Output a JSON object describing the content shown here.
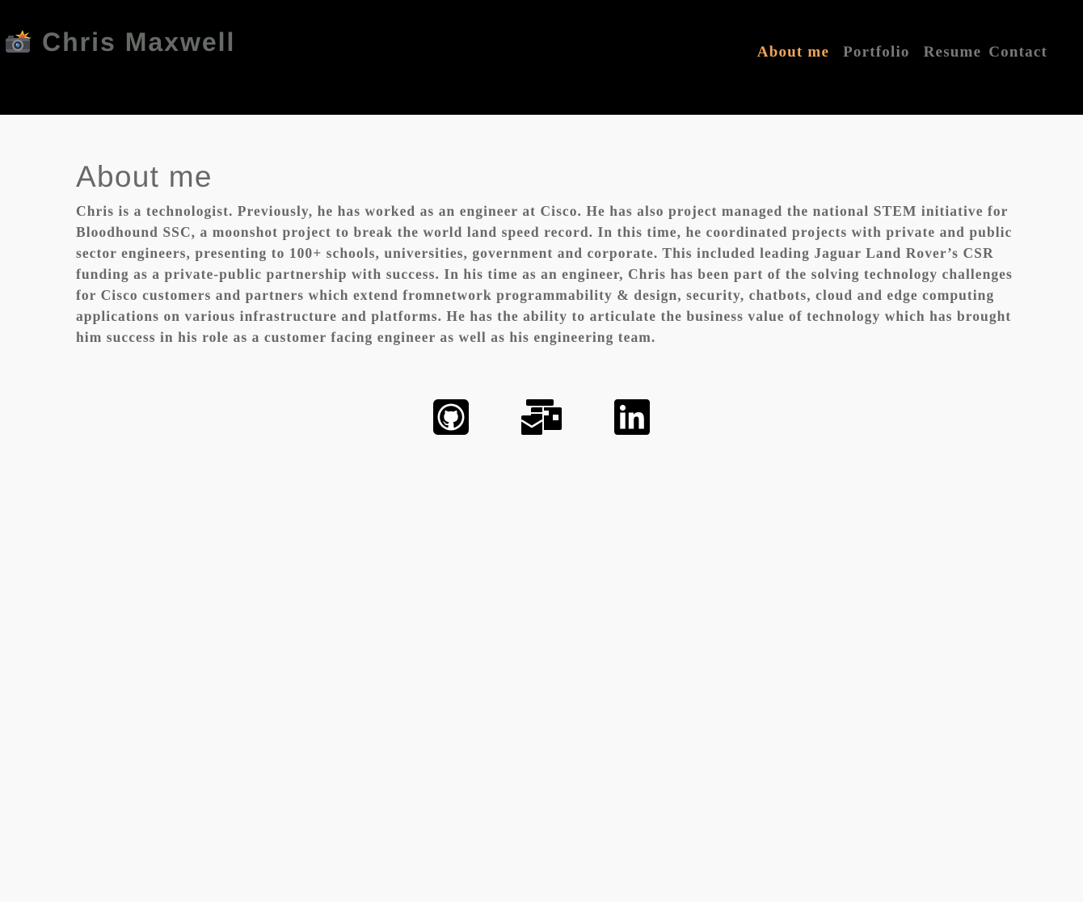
{
  "header": {
    "brand_name": "Chris Maxwell",
    "brand_icon": "camera-flash-icon"
  },
  "nav": {
    "items": [
      {
        "label": "About me",
        "active": true
      },
      {
        "label": "Portfolio",
        "active": false
      },
      {
        "label": "Resume",
        "active": false
      },
      {
        "label": "Contact",
        "active": false
      }
    ]
  },
  "main": {
    "title": "About me",
    "bio": "Chris is a technologist. Previously, he has worked as an engineer at Cisco. He has also project managed the national STEM initiative for Bloodhound SSC, a moonshot project to break the world land speed record. In this time, he coordinated projects with private and public sector engineers, presenting to 100+ schools, universities, government and corporate. This included leading Jaguar Land Rover’s CSR funding as a private-public partnership with success. In his time as an engineer, Chris has been part of the solving technology challenges for Cisco customers and partners which extend fromnetwork programmability & design, security, chatbots, cloud and edge computing applications on various infrastructure and platforms. He has the ability to articulate the business value of technology which has brought him success in his role as a customer facing engineer as well as his engineering team."
  },
  "socials": [
    {
      "icon": "github-icon"
    },
    {
      "icon": "mail-bulk-icon"
    },
    {
      "icon": "linkedin-icon"
    }
  ],
  "colors": {
    "header_bg": "#000000",
    "page_bg": "#f9f9f9",
    "text": "#666a66",
    "nav_text": "#7a7a7a",
    "nav_active": "#f0a45a",
    "icon": "#000000"
  }
}
